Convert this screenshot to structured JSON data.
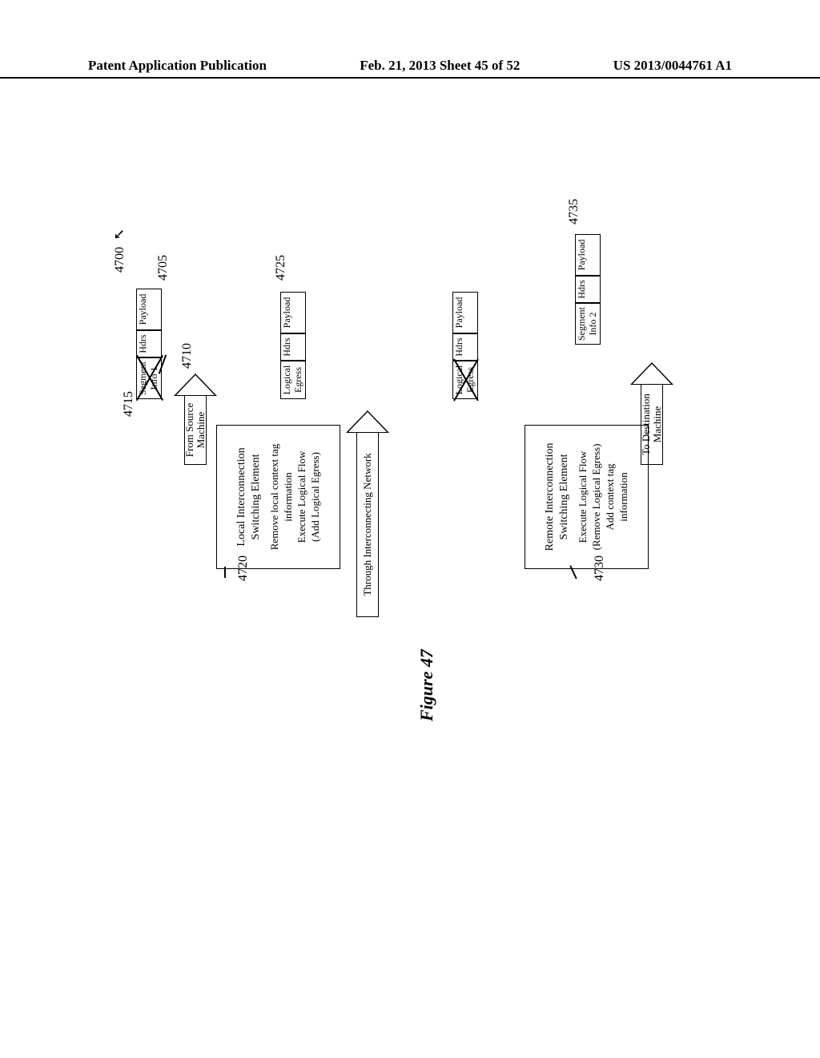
{
  "header": {
    "left": "Patent Application Publication",
    "center": "Feb. 21, 2013  Sheet 45 of 52",
    "right": "US 2013/0044761 A1"
  },
  "figure": {
    "ref_main": "4700",
    "caption": "Figure 47",
    "packets": {
      "p4705": {
        "ref_left": "4715",
        "ref_right": "4705",
        "leader_ref": "4710",
        "cells": [
          "Segment\nInfo 1",
          "Hdrs",
          "Payload"
        ]
      },
      "p4725": {
        "ref": "4725",
        "cells": [
          "Logical\nEgress",
          "Hdrs",
          "Payload"
        ]
      },
      "p_mid": {
        "cells": [
          "Logical\nEgress",
          "Hdrs",
          "Payload"
        ]
      },
      "p4735": {
        "ref": "4735",
        "cells": [
          "Segment\nInfo 2",
          "Hdrs",
          "Payload"
        ]
      }
    },
    "arrows": {
      "a_from_src": "From Source\nMachine",
      "a_through": "Through Interconnecting Network",
      "a_to_dest": "To Destination\nMachine"
    },
    "se_boxes": {
      "se4720": {
        "ref": "4720",
        "title": "Local Interconnection\nSwitching Element",
        "line1": "Remove local context tag\ninformation",
        "line2": "Execute Logical Flow\n(Add Logical Egress)"
      },
      "se4730": {
        "ref": "4730",
        "title": "Remote Interconnection\nSwitching Element",
        "line1": "Execute Logical Flow\n(Remove Logical Egress)",
        "line2": "Add context tag\ninformation"
      }
    }
  }
}
